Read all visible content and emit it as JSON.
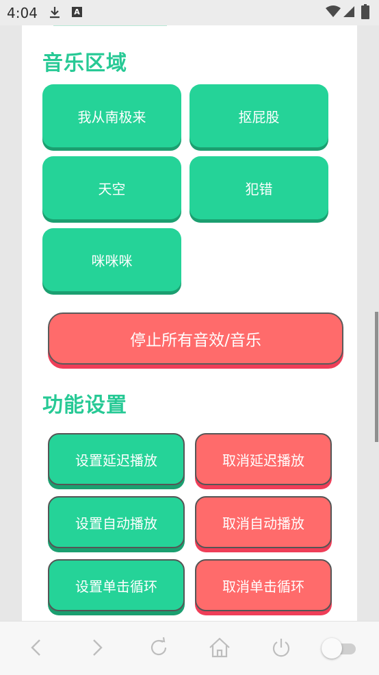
{
  "status_bar": {
    "time": "4:04",
    "icons": [
      "download-icon",
      "a-app-icon",
      "wifi-icon",
      "signal-icon",
      "battery-icon"
    ]
  },
  "sections": {
    "music": {
      "title": "音乐区域",
      "buttons": [
        "我从南极来",
        "抠屁股",
        "天空",
        "犯错",
        "咪咪咪"
      ]
    },
    "stop_all_label": "停止所有音效/音乐",
    "settings": {
      "title": "功能设置",
      "set_delay": "设置延迟播放",
      "cancel_delay": "取消延迟播放",
      "set_auto": "设置自动播放",
      "cancel_auto": "取消自动播放",
      "set_loop": "设置单击循环",
      "cancel_loop": "取消单击循环"
    }
  },
  "toolbar": {
    "icons": [
      "back-icon",
      "forward-icon",
      "refresh-icon",
      "home-icon",
      "power-icon",
      "toggle-switch"
    ],
    "toggle_on": false
  },
  "colors": {
    "accent_green": "#25d398",
    "accent_red": "#ff6b6b",
    "title_green": "#27c995"
  }
}
